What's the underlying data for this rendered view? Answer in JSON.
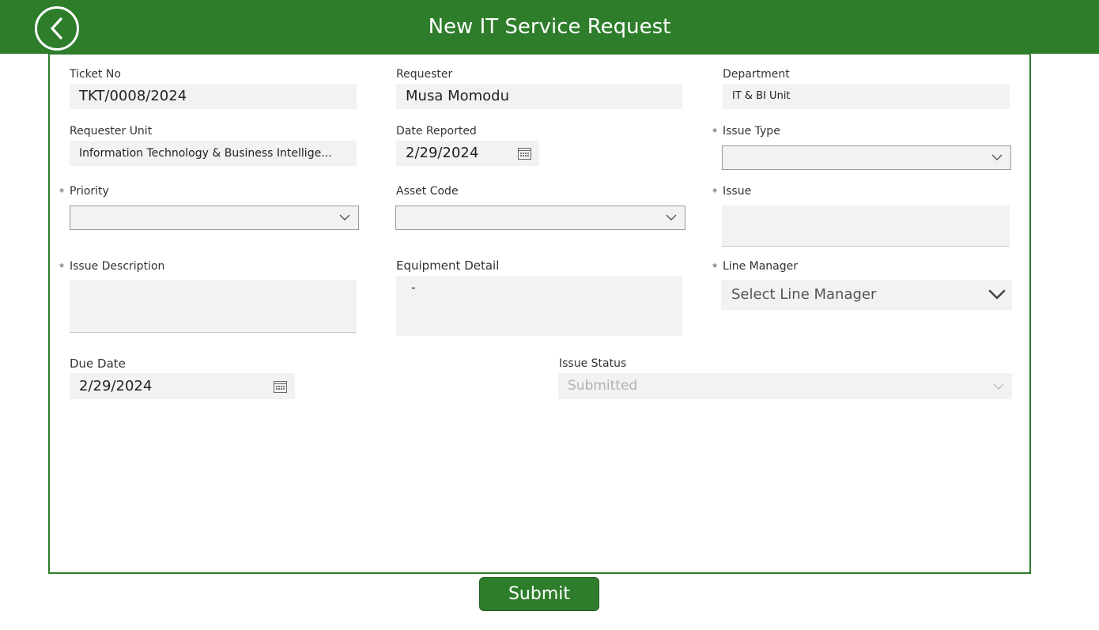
{
  "header": {
    "title": "New IT Service Request",
    "back_icon": "chevron-left-icon"
  },
  "colors": {
    "brand_green": "#2e7d2b",
    "field_bg": "#f3f2f1"
  },
  "form": {
    "ticket_no": {
      "label": "Ticket No",
      "value": "TKT/0008/2024"
    },
    "requester": {
      "label": "Requester",
      "value": "Musa Momodu"
    },
    "department": {
      "label": "Department",
      "value": "IT & BI Unit"
    },
    "requester_unit": {
      "label": "Requester Unit",
      "value": "Information Technology & Business Intellige..."
    },
    "date_reported": {
      "label": "Date Reported",
      "value": "2/29/2024"
    },
    "issue_type": {
      "label": "Issue Type",
      "required_mark": "*",
      "value": ""
    },
    "priority": {
      "label": "Priority",
      "required_mark": "*",
      "value": ""
    },
    "asset_code": {
      "label": "Asset Code",
      "value": ""
    },
    "issue": {
      "label": "Issue",
      "required_mark": "*",
      "value": ""
    },
    "issue_description": {
      "label": "Issue Description",
      "required_mark": "*",
      "value": ""
    },
    "equipment_detail": {
      "label": "Equipment Detail",
      "value": "-"
    },
    "line_manager": {
      "label": "Line Manager",
      "required_mark": "*",
      "placeholder": "Select Line Manager"
    },
    "due_date": {
      "label": "Due Date",
      "value": "2/29/2024"
    },
    "issue_status": {
      "label": "Issue Status",
      "value": "Submitted"
    }
  },
  "submit_label": "Submit"
}
